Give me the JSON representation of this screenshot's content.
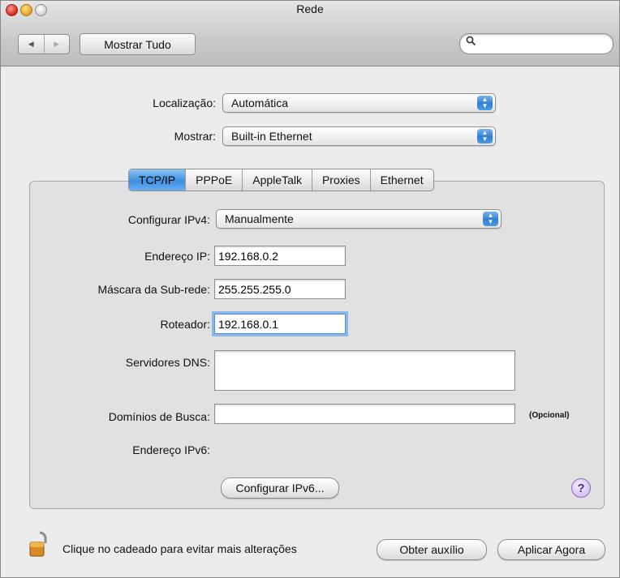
{
  "window": {
    "title": "Rede"
  },
  "toolbar": {
    "back_icon": "◀",
    "forward_icon": "▶",
    "show_all_label": "Mostrar Tudo",
    "search_icon": "search-icon",
    "search_placeholder": ""
  },
  "location": {
    "label": "Localização:",
    "value": "Automática"
  },
  "show": {
    "label": "Mostrar:",
    "value": "Built-in Ethernet"
  },
  "tabs": [
    {
      "label": "TCP/IP",
      "active": true
    },
    {
      "label": "PPPoE",
      "active": false
    },
    {
      "label": "AppleTalk",
      "active": false
    },
    {
      "label": "Proxies",
      "active": false
    },
    {
      "label": "Ethernet",
      "active": false
    }
  ],
  "tcpip": {
    "configure_ipv4": {
      "label": "Configurar IPv4:",
      "value": "Manualmente"
    },
    "ip_address": {
      "label": "Endereço IP:",
      "value": "192.168.0.2"
    },
    "subnet_mask": {
      "label": "Máscara da Sub-rede:",
      "value": "255.255.255.0"
    },
    "router": {
      "label": "Roteador:",
      "value": "192.168.0.1"
    },
    "dns_servers": {
      "label": "Servidores DNS:",
      "value": ""
    },
    "search_domains": {
      "label": "Domínios de Busca:",
      "value": "",
      "hint": "(Opcional)"
    },
    "ipv6_address": {
      "label": "Endereço IPv6:",
      "value": ""
    },
    "configure_ipv6_label": "Configurar IPv6...",
    "help_label": "?"
  },
  "footer": {
    "lock_text": "Clique no cadeado para evitar mais alterações",
    "assist_label": "Obter auxílio",
    "apply_label": "Aplicar Agora"
  },
  "colors": {
    "accent": "#3d8fe0",
    "help": "#c8b0ea"
  }
}
